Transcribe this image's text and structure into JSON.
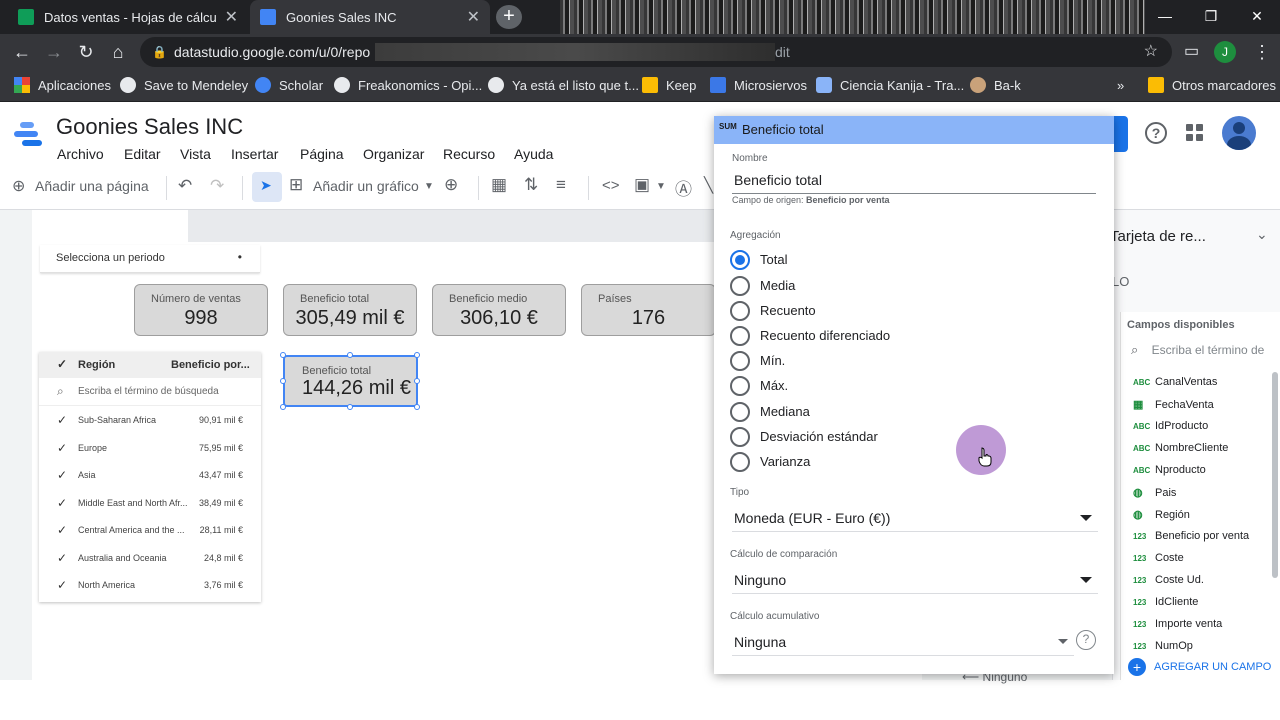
{
  "browser": {
    "tabs": [
      {
        "title": "Datos ventas - Hojas de cálculo de",
        "favicon_color": "#0f9d58"
      },
      {
        "title": "Goonies Sales INC",
        "favicon_color": "#4285f4"
      }
    ],
    "new_tab": "+",
    "url_visible": "datastudio.google.com/u/0/repo",
    "url_tail": "dit",
    "profile_initial": "J",
    "bookmarks": [
      "Aplicaciones",
      "Save to Mendeley",
      "Scholar",
      "Freakonomics - Opi...",
      "Ya está el listo que t...",
      "Keep",
      "Microsiervos",
      "Ciencia Kanija - Tra...",
      "Ba-k",
      "»",
      "Otros marcadores"
    ]
  },
  "app": {
    "title": "Goonies Sales INC",
    "menu": [
      "Archivo",
      "Editar",
      "Vista",
      "Insertar",
      "Página",
      "Organizar",
      "Recurso",
      "Ayuda"
    ]
  },
  "editor_toolbar": {
    "add_page": "Añadir una página",
    "add_chart": "Añadir un gráfico"
  },
  "canvas": {
    "period_selector": "Selecciona un periodo",
    "scorecards": [
      {
        "label": "Número de ventas",
        "value": "998"
      },
      {
        "label": "Beneficio total",
        "value": "305,49 mil €"
      },
      {
        "label": "Beneficio medio",
        "value": "306,10 €"
      },
      {
        "label": "Países",
        "value": "176"
      }
    ],
    "selected_card": {
      "label": "Beneficio total",
      "value": "144,26 mil €"
    },
    "table": {
      "col1": "Región",
      "col2": "Beneficio por...",
      "search_placeholder": "Escriba el término de búsqueda",
      "rows": [
        {
          "name": "Sub-Saharan Africa",
          "value": "90,91 mil €"
        },
        {
          "name": "Europe",
          "value": "75,95 mil €"
        },
        {
          "name": "Asia",
          "value": "43,47 mil €"
        },
        {
          "name": "Middle East and North Afr...",
          "value": "38,49 mil €"
        },
        {
          "name": "Central America and the ...",
          "value": "28,11 mil €"
        },
        {
          "name": "Australia and Oceania",
          "value": "24,8 mil €"
        },
        {
          "name": "North America",
          "value": "3,76 mil €"
        }
      ]
    }
  },
  "popup": {
    "badge": "SUM",
    "header": "Beneficio total",
    "name_label": "Nombre",
    "name_value": "Beneficio total",
    "source_prefix": "Campo de origen: ",
    "source_value": "Beneficio por venta",
    "aggregation_label": "Agregación",
    "aggregation_options": [
      "Total",
      "Media",
      "Recuento",
      "Recuento diferenciado",
      "Mín.",
      "Máx.",
      "Mediana",
      "Desviación estándar",
      "Varianza"
    ],
    "aggregation_selected": "Total",
    "type_label": "Tipo",
    "type_value": "Moneda (EUR - Euro (€))",
    "comparison_label": "Cálculo de comparación",
    "comparison_value": "Ninguno",
    "cumulative_label": "Cálculo acumulativo",
    "cumulative_value": "Ninguna",
    "behind_text": "Ninguno"
  },
  "right_panel": {
    "title": "Tarjeta de re...",
    "subtitle_fragment": "LO",
    "fields_header": "Campos disponibles",
    "search_placeholder": "Escriba el término de",
    "fields": [
      {
        "type": "ABC",
        "name": "CanalVentas"
      },
      {
        "type": "date",
        "name": "FechaVenta"
      },
      {
        "type": "ABC",
        "name": "IdProducto"
      },
      {
        "type": "ABC",
        "name": "NombreCliente"
      },
      {
        "type": "ABC",
        "name": "Nproducto"
      },
      {
        "type": "geo",
        "name": "Pais"
      },
      {
        "type": "geo",
        "name": "Región"
      },
      {
        "type": "123",
        "name": "Beneficio por venta"
      },
      {
        "type": "123",
        "name": "Coste"
      },
      {
        "type": "123",
        "name": "Coste Ud."
      },
      {
        "type": "123",
        "name": "IdCliente"
      },
      {
        "type": "123",
        "name": "Importe venta"
      },
      {
        "type": "123",
        "name": "NumOp"
      }
    ],
    "add_field": "AGREGAR UN CAMPO"
  },
  "colors": {
    "accent": "#1a73e8",
    "popup_header": "#8ab4f8",
    "card_bg": "#d9d9d9",
    "field_type": "#1e8e3e"
  }
}
